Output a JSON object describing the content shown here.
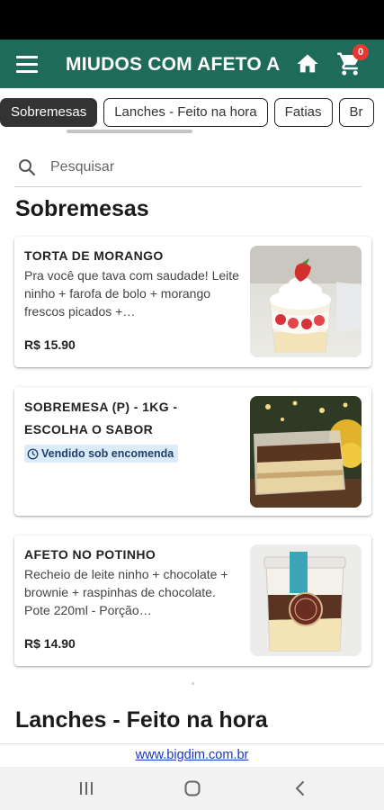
{
  "app": {
    "title": "MIUDOS COM AFETO A",
    "cart_count": "0"
  },
  "tabs": [
    {
      "label": "Sobremesas",
      "active": true
    },
    {
      "label": "Lanches - Feito na hora",
      "active": false
    },
    {
      "label": "Fatias",
      "active": false
    },
    {
      "label": "Br",
      "active": false
    }
  ],
  "search": {
    "placeholder": "Pesquisar"
  },
  "sections": [
    {
      "title": "Sobremesas",
      "items": [
        {
          "name": "TORTA DE MORANGO",
          "description": "Pra você que tava com saudade! Leite ninho + farofa de bolo + morango frescos picados +…",
          "price": "R$ 15.90",
          "image": "strawberry-cream-cup"
        },
        {
          "name": "SOBREMESA (P) - 1KG - ESCOLHA O SABOR",
          "badge": "Vendido sob encomenda",
          "image": "layered-dessert-tray"
        },
        {
          "name": "AFETO NO POTINHO",
          "description": "Recheio de leite ninho + chocolate + brownie + raspinhas de chocolate. Pote 220ml - Porção…",
          "price": "R$ 14.90",
          "image": "dessert-pot"
        }
      ]
    },
    {
      "title": "Lanches - Feito na hora"
    }
  ],
  "footer": {
    "link": "www.bigdim.com.br"
  },
  "colors": {
    "app_bar": "#1e6b5a",
    "badge_bg": "#dcebfa",
    "cart_badge": "#e53935",
    "link": "#1a35c8"
  }
}
